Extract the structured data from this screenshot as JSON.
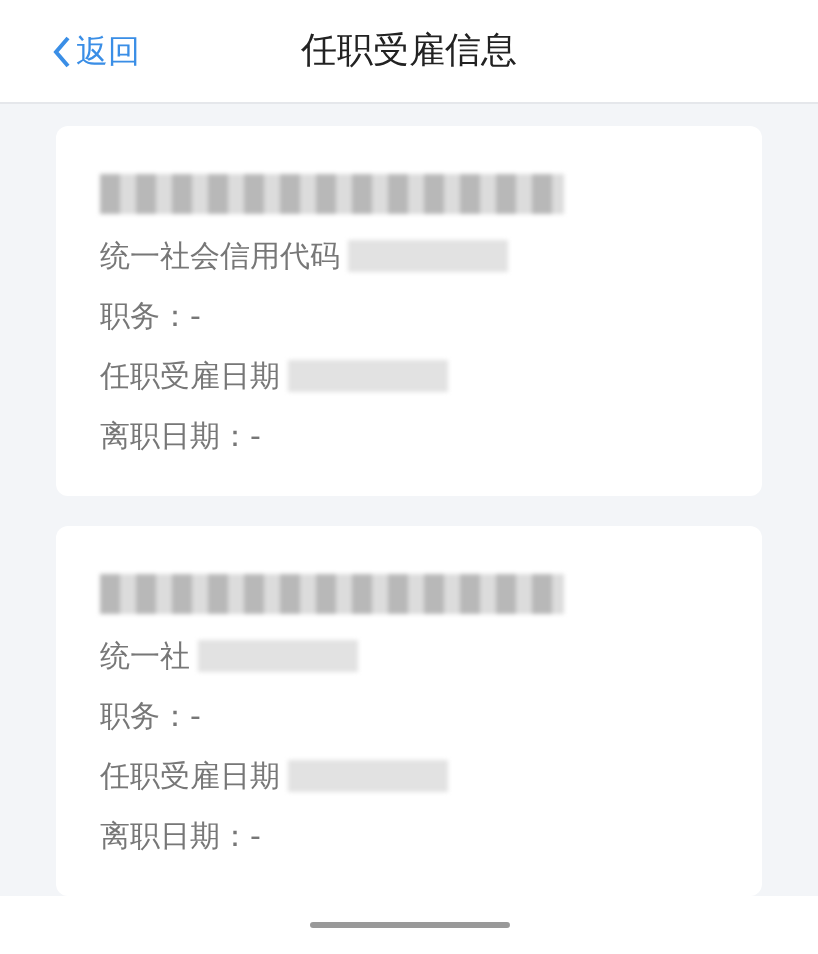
{
  "nav": {
    "back": "返回",
    "title": "任职受雇信息"
  },
  "cards": [
    {
      "name_redacted": true,
      "rows": [
        {
          "label": "统一社会信用代码",
          "redacted": true
        },
        {
          "label": "职务：-",
          "redacted": false
        },
        {
          "label": "任职受雇日期",
          "redacted": true
        },
        {
          "label": "离职日期：-",
          "redacted": false
        }
      ]
    },
    {
      "name_redacted": true,
      "rows": [
        {
          "label": "统一社",
          "redacted": true
        },
        {
          "label": "职务：-",
          "redacted": false
        },
        {
          "label": "任职受雇日期",
          "redacted": true
        },
        {
          "label": "离职日期：-",
          "redacted": false
        }
      ]
    }
  ]
}
